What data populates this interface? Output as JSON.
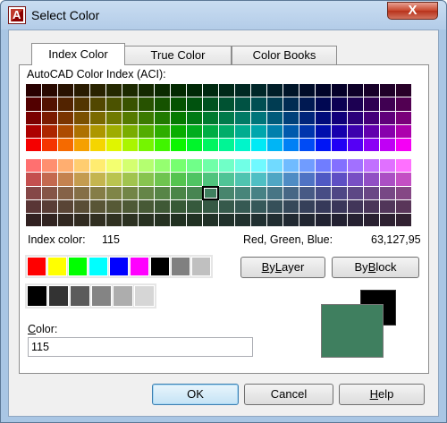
{
  "window": {
    "title": "Select Color",
    "close_label": "X"
  },
  "tabs": [
    {
      "label": "Index Color",
      "active": true
    },
    {
      "label": "True Color",
      "active": false
    },
    {
      "label": "Color Books",
      "active": false
    }
  ],
  "aci_label": "AutoCAD Color Index (ACI):",
  "info": {
    "index_color_label": "Index color:",
    "index_color_value": "115",
    "rgb_label": "Red, Green, Blue:",
    "rgb_value": "63,127,95"
  },
  "standard_colors": [
    "#ff0000",
    "#ffff00",
    "#00ff00",
    "#00ffff",
    "#0000ff",
    "#ff00ff",
    "#000000",
    "#808080",
    "#c0c0c0"
  ],
  "gray_colors": [
    "#000000",
    "#333333",
    "#5b5b5b",
    "#848484",
    "#adadad",
    "#d6d6d6"
  ],
  "buttons": {
    "bylayer": "ByLayer",
    "byblock": "ByBlock",
    "ok": "OK",
    "cancel": "Cancel",
    "help": "Help"
  },
  "color_field": {
    "label": "Color:",
    "value": "115"
  },
  "preview": {
    "new_color": "#3f7f5f",
    "old_color": "#000000"
  },
  "accent_colors": {
    "title_bar": "#b3cce8",
    "close_button": "#c7462c",
    "selection_outline": "#000000"
  }
}
